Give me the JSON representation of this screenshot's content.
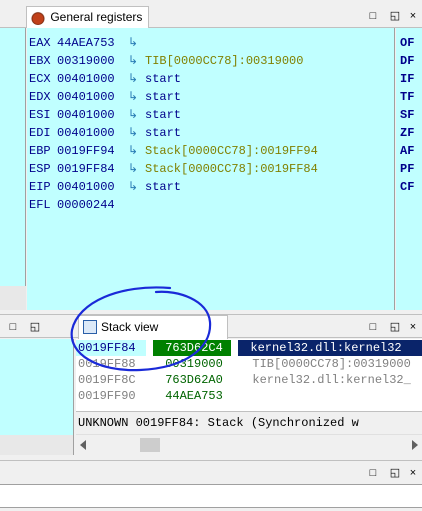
{
  "registers_panel": {
    "title": "General registers",
    "rows": [
      {
        "name": "EAX",
        "value": "44AEA753",
        "arrow": "↳",
        "target": ""
      },
      {
        "name": "EBX",
        "value": "00319000",
        "arrow": "↳",
        "target": "TIB[0000CC78]:00319000"
      },
      {
        "name": "ECX",
        "value": "00401000",
        "arrow": "↳",
        "target": "start"
      },
      {
        "name": "EDX",
        "value": "00401000",
        "arrow": "↳",
        "target": "start"
      },
      {
        "name": "ESI",
        "value": "00401000",
        "arrow": "↳",
        "target": "start"
      },
      {
        "name": "EDI",
        "value": "00401000",
        "arrow": "↳",
        "target": "start"
      },
      {
        "name": "EBP",
        "value": "0019FF94",
        "arrow": "↳",
        "target": "Stack[0000CC78]:0019FF94"
      },
      {
        "name": "ESP",
        "value": "0019FF84",
        "arrow": "↳",
        "target": "Stack[0000CC78]:0019FF84"
      },
      {
        "name": "EIP",
        "value": "00401000",
        "arrow": "↳",
        "target": "start"
      },
      {
        "name": "EFL",
        "value": "00000244",
        "arrow": "",
        "target": ""
      }
    ],
    "flags": [
      "OF",
      "DF",
      "IF",
      "TF",
      "SF",
      "ZF",
      "AF",
      "PF",
      "CF"
    ]
  },
  "stack_panel": {
    "title": "Stack view",
    "rows": [
      {
        "addr": "0019FF84",
        "value": "763D62C4",
        "comment": "kernel32.dll:kernel32"
      },
      {
        "addr": "0019FF88",
        "value": "00319000",
        "comment": "TIB[0000CC78]:00319000"
      },
      {
        "addr": "0019FF8C",
        "value": "763D62A0",
        "comment": "kernel32.dll:kernel32_"
      },
      {
        "addr": "0019FF90",
        "value": "44AEA753",
        "comment": ""
      }
    ],
    "status_text": "UNKNOWN 0019FF84: Stack (Synchronized w"
  },
  "controls": {
    "close": "□",
    "restore": "◱",
    "close_x": "×"
  },
  "colors": {
    "panel_bg": "#c0ffff",
    "highlight": "#0a246a",
    "green_cell": "#008000",
    "annotation": "#1a2ad8"
  }
}
